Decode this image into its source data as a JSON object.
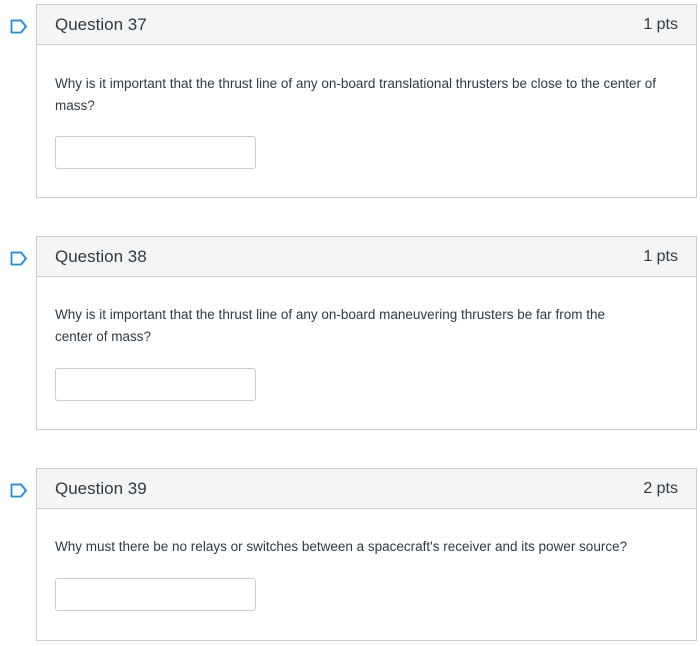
{
  "questions": [
    {
      "title": "Question 37",
      "points": "1 pts",
      "text": "Why is it important that the thrust line of any on-board translational thrusters be close to the center of mass?",
      "answer_value": ""
    },
    {
      "title": "Question 38",
      "points": "1 pts",
      "text": "Why is it important that the thrust line of any on-board maneuvering thrusters be far from the center of mass?",
      "answer_value": ""
    },
    {
      "title": "Question 39",
      "points": "2 pts",
      "text": "Why must there be no relays or switches between a spacecraft's receiver and its power source?",
      "answer_value": ""
    }
  ],
  "colors": {
    "flag": "#1e8ad6",
    "border": "#c7cdd1",
    "header_bg": "#f5f5f5",
    "text": "#2d3b45"
  },
  "icons": {
    "flag": "flag-outline-icon"
  }
}
